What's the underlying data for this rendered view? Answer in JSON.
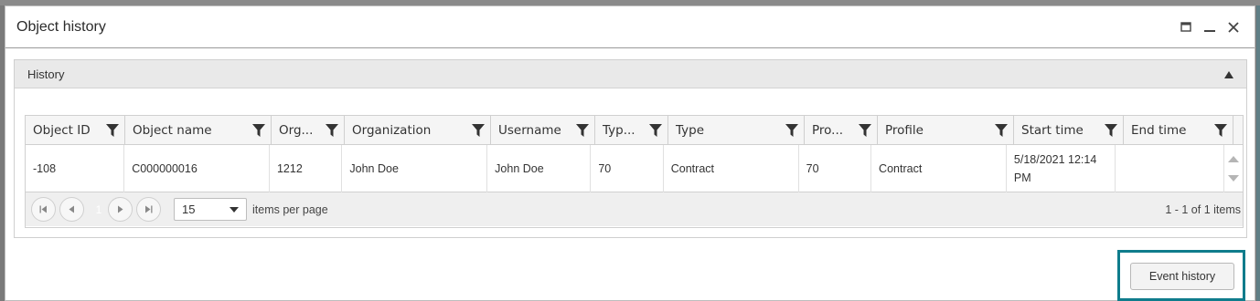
{
  "dialog": {
    "title": "Object history",
    "maximize_icon": "maximize-icon",
    "minimize_icon": "minimize-icon",
    "close_icon": "close-icon"
  },
  "panel": {
    "title": "History",
    "collapse_icon": "triangle-up-icon"
  },
  "grid": {
    "columns": [
      {
        "label": "Object ID"
      },
      {
        "label": "Object name"
      },
      {
        "label": "Org..."
      },
      {
        "label": "Organization"
      },
      {
        "label": "Username"
      },
      {
        "label": "Typ..."
      },
      {
        "label": "Type"
      },
      {
        "label": "Pro..."
      },
      {
        "label": "Profile"
      },
      {
        "label": "Start time"
      },
      {
        "label": "End time"
      }
    ],
    "rows": [
      [
        "-108",
        "C000000016",
        "1212",
        "John Doe",
        "John Doe",
        "70",
        "Contract",
        "70",
        "Contract",
        "5/18/2021 12:14 PM",
        ""
      ]
    ]
  },
  "pager": {
    "current_page": "1",
    "page_size": "15",
    "items_per_page_label": "items per page",
    "info": "1 - 1 of 1 items"
  },
  "actions": {
    "event_history_label": "Event history"
  },
  "colors": {
    "highlight": "#0f7c8c"
  }
}
